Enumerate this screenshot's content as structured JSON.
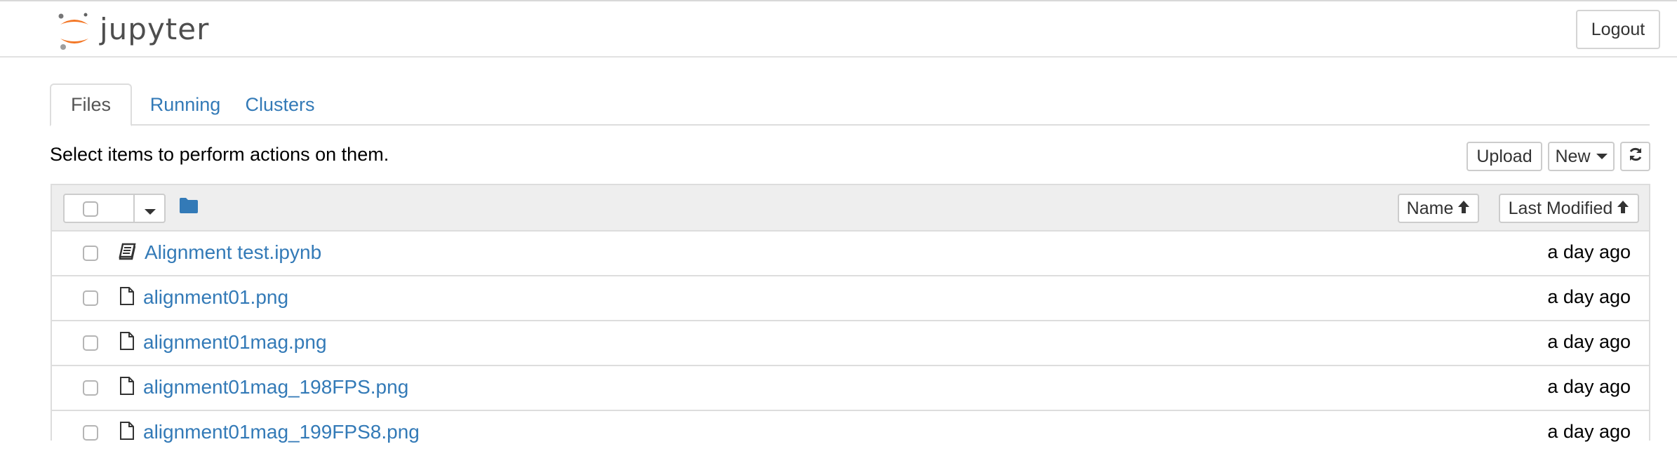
{
  "header": {
    "logo_text": "jupyter",
    "logout_label": "Logout"
  },
  "tabs": [
    {
      "label": "Files",
      "active": true
    },
    {
      "label": "Running",
      "active": false
    },
    {
      "label": "Clusters",
      "active": false
    }
  ],
  "toolbar": {
    "hint": "Select items to perform actions on them.",
    "upload_label": "Upload",
    "new_label": "New",
    "refresh_icon": "refresh-icon"
  },
  "list_header": {
    "folder_icon": "folder-icon",
    "sort_name_label": "Name",
    "sort_modified_label": "Last Modified"
  },
  "files": [
    {
      "name": "Alignment test.ipynb",
      "modified": "a day ago",
      "icon": "notebook-icon"
    },
    {
      "name": "alignment01.png",
      "modified": "a day ago",
      "icon": "file-icon"
    },
    {
      "name": "alignment01mag.png",
      "modified": "a day ago",
      "icon": "file-icon"
    },
    {
      "name": "alignment01mag_198FPS.png",
      "modified": "a day ago",
      "icon": "file-icon"
    },
    {
      "name": "alignment01mag_199FPS8.png",
      "modified": "a day ago",
      "icon": "file-icon"
    }
  ],
  "colors": {
    "link": "#337ab7",
    "logo_orange": "#f37726",
    "header_bg": "#eeeeee"
  }
}
